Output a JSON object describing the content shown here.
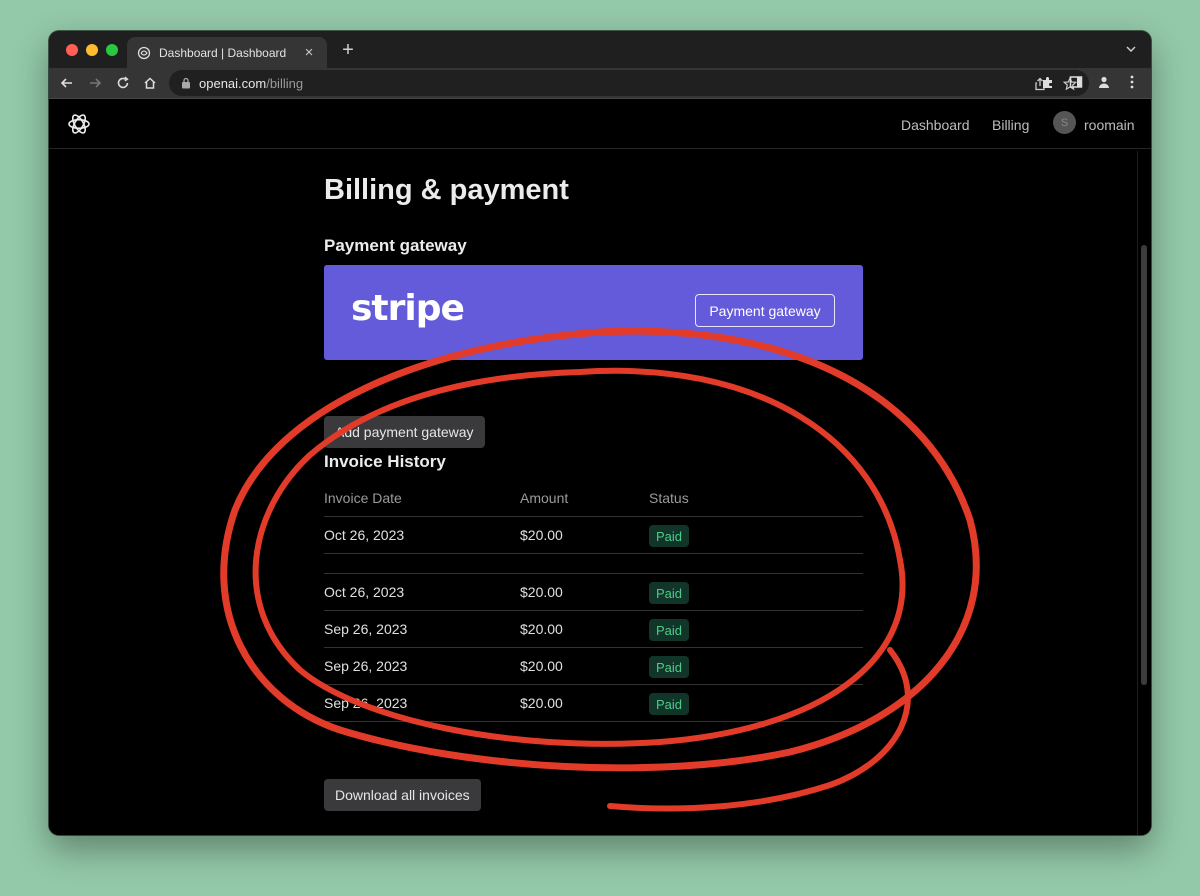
{
  "browser": {
    "tab_title": "Dashboard | Dashboard",
    "new_tab": "+",
    "close_glyph": "×",
    "url_host": "openai.com",
    "url_path": "/billing"
  },
  "topnav": {
    "links": [
      "Dashboard",
      "Billing"
    ],
    "avatar_letter": "S",
    "username": "roomain"
  },
  "page": {
    "title": "Billing & payment",
    "gateway_heading": "Payment gateway",
    "stripe_word": "stripe",
    "gateway_button": "Payment gateway",
    "add_gateway_button": "Add payment gateway",
    "invoice_heading": "Invoice History",
    "download_button": "Download all invoices"
  },
  "invoices": {
    "headers": [
      "Invoice Date",
      "Amount",
      "Status"
    ],
    "rows": [
      {
        "date": "Oct 26, 2023",
        "amount": "$20.00",
        "status": "Paid"
      },
      {
        "date": "Oct 26, 2023",
        "amount": "$20.00",
        "status": "Paid"
      },
      {
        "date": "Sep 26, 2023",
        "amount": "$20.00",
        "status": "Paid"
      },
      {
        "date": "Sep 26, 2023",
        "amount": "$20.00",
        "status": "Paid"
      },
      {
        "date": "Sep 26, 2023",
        "amount": "$20.00",
        "status": "Paid"
      }
    ]
  },
  "colors": {
    "stripe_purple": "#635bd9",
    "paid_badge_bg": "#12352a",
    "paid_badge_text": "#4ecb8a",
    "annotation_red": "#e23b2a",
    "backdrop_green": "#93c8a8"
  },
  "icons": [
    "back-icon",
    "forward-icon",
    "reload-icon",
    "home-icon",
    "lock-icon",
    "share-icon",
    "star-icon",
    "extensions-icon",
    "sidepanel-icon",
    "profile-icon",
    "menu-icon",
    "openai-logo",
    "sparkle-watermark"
  ]
}
